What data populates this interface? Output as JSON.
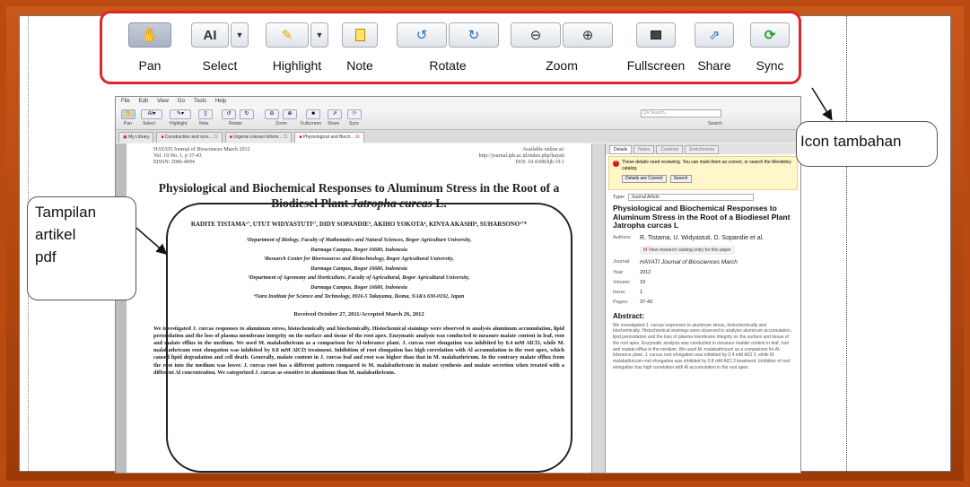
{
  "toolbar": {
    "pan": "Pan",
    "select": "Select",
    "highlight": "Highlight",
    "note": "Note",
    "rotate": "Rotate",
    "zoom": "Zoom",
    "fullscreen": "Fullscreen",
    "share": "Share",
    "sync": "Sync"
  },
  "callouts": {
    "icon": "Icon tambahan",
    "pdf_line1": "Tampilan",
    "pdf_line2": "artikel",
    "pdf_line3": "pdf"
  },
  "app": {
    "menu": [
      "File",
      "Edit",
      "View",
      "Go",
      "Tools",
      "Help"
    ],
    "search_placeholder": "Q▾ Search...",
    "search_label": "Search",
    "mini_labels": {
      "pan": "Pan",
      "select": "Select",
      "highlight": "Highlight",
      "note": "Note",
      "rotate": "Rotate",
      "zoom": "Zoom",
      "fullscreen": "Fullscreen",
      "share": "Share",
      "sync": "Sync"
    },
    "tabs": [
      "My Library",
      "Construction and scre...",
      "Urgensi Literasi Inform...",
      "Physiological and Bioch..."
    ]
  },
  "pdf": {
    "journal": "HAYATI Journal of Biosciences March 2012",
    "volume": "Vol. 19 No. 1, p 37-43",
    "eissn": "EISSN: 2086-4094",
    "online": "Available online at:",
    "url": "http://journal.ipb.ac.id/index.php/hayati",
    "doi": "DOI: 10.4308/hjb.19.1",
    "title_part1": "Physiological and Biochemical Responses to Aluminum Stress in the Root of a Biodiesel Plant ",
    "title_italic": "Jatropha curcas",
    "title_end": " L.",
    "authors": "RADITE TISTAMA¹ʼ, UTUT WIDYASTUTI¹ʼ, DIDY SOPANDIE³, AKIHO YOKOTA⁴, KINYA AKASHI⁴, SUHARSONO¹ʼ*",
    "affil1": "¹Department of Biology, Faculty of Mathematics and Natural Sciences, Bogor Agriculture University,",
    "affil1b": "Darmaga Campus, Bogor 16680, Indonesia",
    "affil2": "²Research Center for Bioresources and Biotechnology, Bogor Agricultural University,",
    "affil2b": "Darmaga Campus, Bogor 16680, Indonesia",
    "affil3": "³Department of Agronomy and Horticulture, Faculty of Agricultural, Bogor Agricultural University,",
    "affil3b": "Darmaga Campus, Bogor 16680, Indonesia",
    "affil4": "⁴Nara Institute for Science and Technology, 8916-5 Takayama, Ikoma, NARA 630-0192, Japan",
    "received": "Received October 27, 2011/Accepted March 26, 2012",
    "abstract": "We investigated J. curcas responses to aluminum stress, histochemically and biochemically. Histochemical stainings were observed to analysis aluminum accumulation, lipid peroxidation and the loss of plasma membrane integrity on the surface and tissue of the root apex. Enzymatic analysis was conducted to measure malate content in leaf, root and malate efflux in the medium. We used M. malabathricum as a comparison for Al-tolerance plant. J. curcas root elongation was inhibited by 0.4 mM AlCl3, while M. malabathricum root elongation was inhibited by 0.8 mM AlCl3 treatment. Inhibition of root elongation has high correlation with Al accumulation in the root apex, which caused lipid degradation and cell death. Generally, malate content in J. curcas leaf and root was higher than that in M. malabathricum. In the contrary malate efflux from the root into the medium was lower. J. curcas root has a different pattern compared to M. malabathricum in malate synthesis and malate secretion when treated with a different Al concentration. We categorized J. curcas as sensitive to aluminum than M. malabathricum."
  },
  "details": {
    "tabs": [
      "Details",
      "Notes",
      "Contents",
      "Enrichments"
    ],
    "warning": "These details need reviewing. You can mark them as correct, or search the Mendeley catalog.",
    "btn_correct": "Details are Correct",
    "btn_search": "Search",
    "type_label": "Type:",
    "type_value": "Journal Article",
    "title": "Physiological and Biochemical Responses to Aluminum Stress in the Root of a Biodiesel Plant Jatropha curcas L",
    "authors_label": "Authors:",
    "authors_value": "R. Tistama, U. Widyastuti, D. Sopandie et al.",
    "catalog": "View research catalog entry for this paper",
    "journal_label": "Journal:",
    "journal_value": "HAYATI Journal of Biosciences March",
    "year_label": "Year:",
    "year_value": "2012",
    "volume_label": "Volume:",
    "volume_value": "19",
    "issue_label": "Issue:",
    "issue_value": "1",
    "pages_label": "Pages:",
    "pages_value": "37-43",
    "abstract_title": "Abstract:",
    "abstract_text": "We investigated J. curcas responses to aluminum stress, histochemically and biochemically. Histochemical stainings were observed to analysis aluminum accumulation, lipid peroxidation and the loss of plasma membrane integrity on the surface and tissue of the root apex. Enzymatic analysis was conducted to measure malate content in leaf, root and malate efflux in the medium. We used M. malabathricum as a comparison for Al-tolerance plant. J. curcas root elongation was inhibited by 0.4 mM AlCl 3, while M. malabathricum root elongation was inhibited by 0.8 mM AlCl 3 treatment. Inhibition of root elongation has high correlation with Al accumulation in the root apex."
  },
  "colors": {
    "frame": "#b94a10",
    "callout_border": "#e0242b",
    "sync_green": "#2e9a2e",
    "tab_icon_red": "#c8102e"
  }
}
